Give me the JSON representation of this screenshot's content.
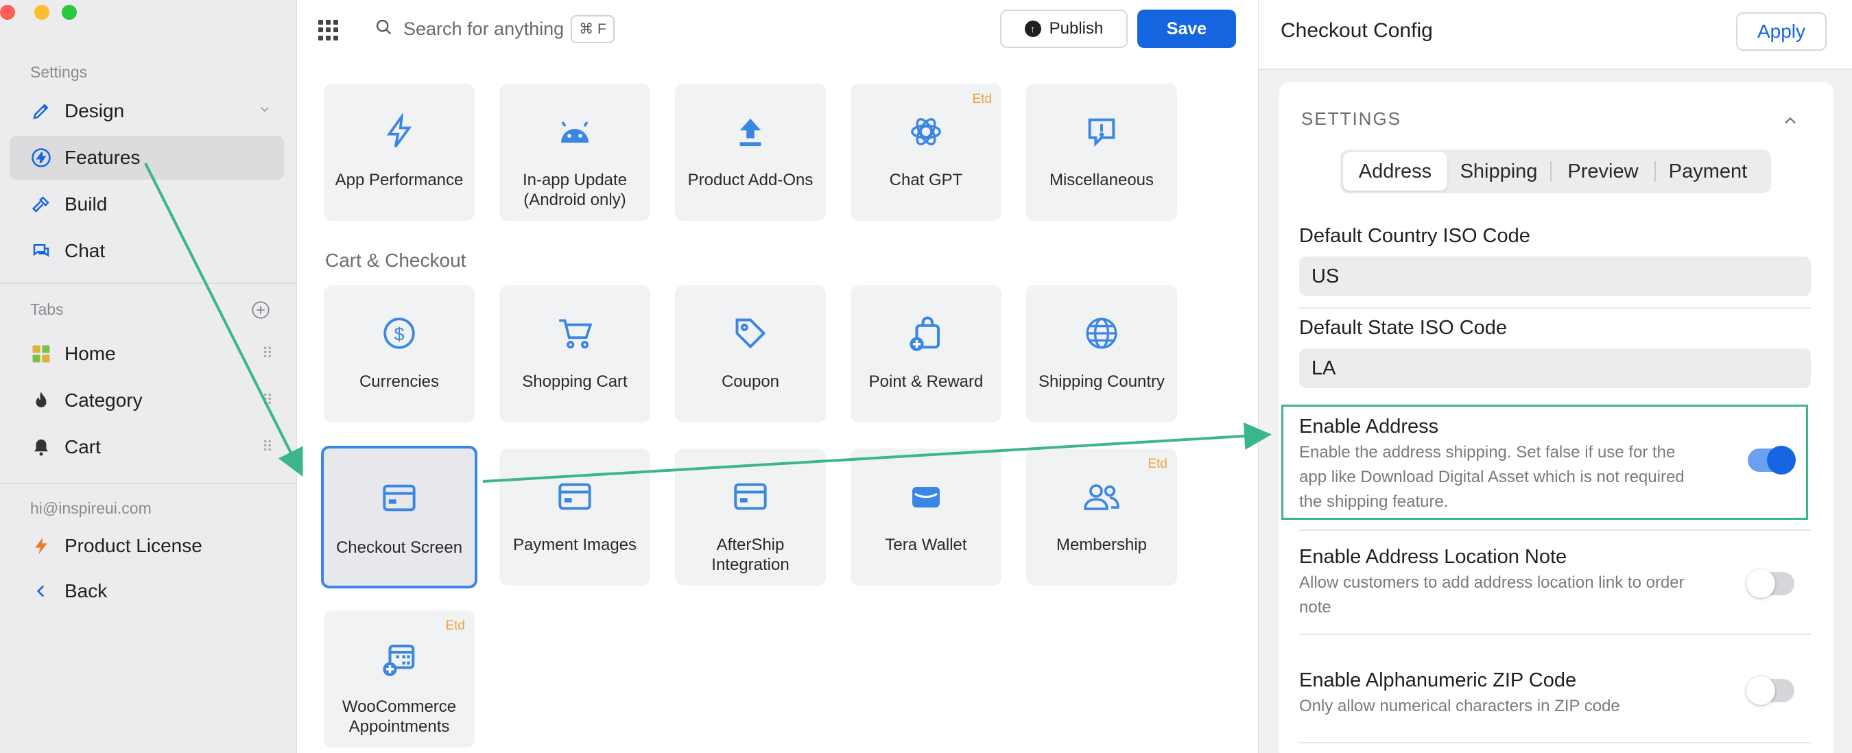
{
  "window": {
    "traffic_colors": [
      "#ff5f57",
      "#febc2e",
      "#28c840"
    ]
  },
  "sidebar": {
    "settings_label": "Settings",
    "settings_items": [
      {
        "label": "Design"
      },
      {
        "label": "Features"
      },
      {
        "label": "Build"
      },
      {
        "label": "Chat"
      }
    ],
    "tabs_label": "Tabs",
    "tab_items": [
      {
        "label": "Home"
      },
      {
        "label": "Category"
      },
      {
        "label": "Cart"
      }
    ],
    "email": "hi@inspireui.com",
    "license_label": "Product License",
    "back_label": "Back"
  },
  "topbar": {
    "search_placeholder": "Search for anything",
    "shortcut": "⌘ F",
    "publish_label": "Publish",
    "save_label": "Save"
  },
  "features": {
    "row1": [
      {
        "label": "App Performance",
        "icon": "bolt-icon"
      },
      {
        "label": "In-app Update (Android only)",
        "icon": "android-icon"
      },
      {
        "label": "Product Add-Ons",
        "icon": "upload-icon"
      },
      {
        "label": "Chat GPT",
        "icon": "openai-icon",
        "badge": "Etd"
      },
      {
        "label": "Miscellaneous",
        "icon": "alert-bubble-icon"
      }
    ],
    "section_title": "Cart & Checkout",
    "row2": [
      {
        "label": "Currencies",
        "icon": "dollar-icon"
      },
      {
        "label": "Shopping Cart",
        "icon": "cart-icon"
      },
      {
        "label": "Coupon",
        "icon": "tag-icon"
      },
      {
        "label": "Point & Reward",
        "icon": "bag-plus-icon"
      },
      {
        "label": "Shipping Country",
        "icon": "globe-icon"
      }
    ],
    "row3": [
      {
        "label": "Checkout Screen",
        "icon": "card-icon",
        "selected": true
      },
      {
        "label": "Payment Images",
        "icon": "card-icon"
      },
      {
        "label": "AfterShip Integration",
        "icon": "card-icon"
      },
      {
        "label": "Tera Wallet",
        "icon": "wallet-icon"
      },
      {
        "label": "Membership",
        "icon": "users-icon",
        "badge": "Etd"
      }
    ],
    "row4": [
      {
        "label": "WooCommerce Appointments",
        "icon": "calendar-plus-icon",
        "badge": "Etd"
      }
    ]
  },
  "panel": {
    "title": "Checkout Config",
    "apply_label": "Apply",
    "settings_label": "SETTINGS",
    "segments": [
      {
        "label": "Address",
        "active": true
      },
      {
        "label": "Shipping"
      },
      {
        "label": "Preview"
      },
      {
        "label": "Payment"
      }
    ],
    "country_label": "Default Country ISO Code",
    "country_value": "US",
    "state_label": "Default State ISO Code",
    "state_value": "LA",
    "rows": [
      {
        "title": "Enable Address",
        "desc": "Enable the address shipping. Set false if use for the app like Download Digital Asset which is not required the shipping feature.",
        "on": true
      },
      {
        "title": "Enable Address Location Note",
        "desc": "Allow customers to add address location link to order note",
        "on": false
      },
      {
        "title": "Enable Alphanumeric ZIP Code",
        "desc": "Only allow numerical characters in ZIP code",
        "on": false
      }
    ]
  },
  "colors": {
    "accent": "#1565e0",
    "annotation": "#3bb68b",
    "badge": "#e8a63a"
  }
}
